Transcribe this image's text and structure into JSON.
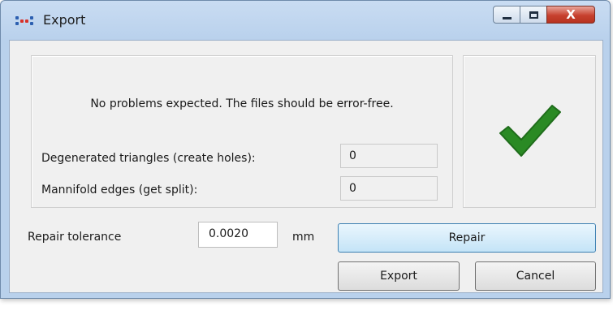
{
  "window": {
    "title": "Export",
    "controls": {
      "minimize_icon": "minimize-icon",
      "maximize_icon": "maximize-icon",
      "close_glyph": "X"
    }
  },
  "status": {
    "message": "No problems expected. The files should be error-free.",
    "result_icon": "checkmark-icon",
    "result_color": "#2a8a24"
  },
  "stats": {
    "degenerated": {
      "label": "Degenerated triangles (create holes):",
      "value": "0"
    },
    "manifold": {
      "label": "Mannifold edges (get split):",
      "value": "0"
    }
  },
  "repair": {
    "tolerance_label": "Repair tolerance",
    "tolerance_value": "0.0020",
    "unit": "mm",
    "button_label": "Repair"
  },
  "actions": {
    "export_label": "Export",
    "cancel_label": "Cancel"
  },
  "colors": {
    "titlebar": "#c9dcf2",
    "client_bg": "#f0f0f0",
    "close_button": "#c7412f"
  }
}
